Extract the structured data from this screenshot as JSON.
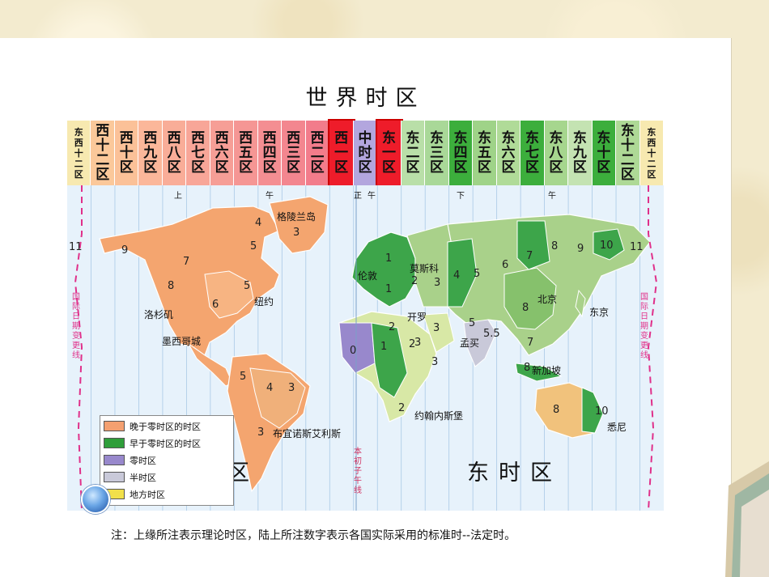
{
  "title": "世界时区",
  "zones": [
    {
      "label": "东西十二区",
      "color": "#f7e9b0",
      "small": true
    },
    {
      "label": "西十二区",
      "color": "#fbc89a"
    },
    {
      "label": "西十区",
      "color": "#fbc198"
    },
    {
      "label": "西九区",
      "color": "#fbb79a"
    },
    {
      "label": "西八区",
      "color": "#f9ad98"
    },
    {
      "label": "西七区",
      "color": "#f8a698"
    },
    {
      "label": "西六区",
      "color": "#f69e96"
    },
    {
      "label": "西五区",
      "color": "#f59694"
    },
    {
      "label": "西四区",
      "color": "#f48e92"
    },
    {
      "label": "西三区",
      "color": "#f3868f"
    },
    {
      "label": "西二区",
      "color": "#f27c8b"
    },
    {
      "label": "西一区",
      "color": "#ee1c2a",
      "border": "#c00"
    },
    {
      "label": "中时区",
      "color": "#b3a6de"
    },
    {
      "label": "东一区",
      "color": "#ee1c2a",
      "border": "#c00"
    },
    {
      "label": "东二区",
      "color": "#b9dfa8"
    },
    {
      "label": "东三区",
      "color": "#a9d898"
    },
    {
      "label": "东四区",
      "color": "#3cae3c"
    },
    {
      "label": "东五区",
      "color": "#9fd388"
    },
    {
      "label": "东六区",
      "color": "#b0db98"
    },
    {
      "label": "东七区",
      "color": "#3cae3c"
    },
    {
      "label": "东八区",
      "color": "#a6d68e"
    },
    {
      "label": "东九区",
      "color": "#c4e3b2"
    },
    {
      "label": "东十区",
      "color": "#3cae3c"
    },
    {
      "label": "东十二区",
      "color": "#aed996",
      "small_plus": true
    },
    {
      "label": "东西十二区",
      "color": "#f7e9b0",
      "small": true
    }
  ],
  "ticks": [
    "上",
    "午",
    "正",
    "午",
    "下",
    "午"
  ],
  "cities": [
    "格陵兰岛",
    "洛杉矶",
    "墨西哥城",
    "纽约",
    "布宜诺斯艾利斯",
    "伦敦",
    "莫斯科",
    "开罗",
    "孟买",
    "北京",
    "东京",
    "新加坡",
    "约翰内斯堡",
    "悉尼"
  ],
  "numbers": [
    "11",
    "9",
    "7",
    "8",
    "6",
    "5",
    "5",
    "4",
    "3",
    "5",
    "4",
    "3",
    "3",
    "1",
    "1",
    "2",
    "3",
    "4",
    "5",
    "6",
    "7",
    "8",
    "9",
    "10",
    "11",
    "8",
    "2",
    "3",
    "3",
    "5",
    "5.5",
    "7",
    "8",
    "0",
    "1",
    "2",
    "2",
    "3",
    "8",
    "10"
  ],
  "legend": [
    {
      "label": "晚于零时区的时区",
      "color": "#f4a070"
    },
    {
      "label": "早于零时区的时区",
      "color": "#2f9e3a"
    },
    {
      "label": "零时区",
      "color": "#9888cc"
    },
    {
      "label": "半时区",
      "color": "#c9c9d9"
    },
    {
      "label": "地方时区",
      "color": "#f1e04a"
    }
  ],
  "west_label": "西时区",
  "east_label": "东时区",
  "prime_meridian": "本初子午线",
  "date_line": "国际日期变更线",
  "note": "注：上缘所注表示理论时区，陆上所注数字表示各国实际采用的标准时--法定时。"
}
